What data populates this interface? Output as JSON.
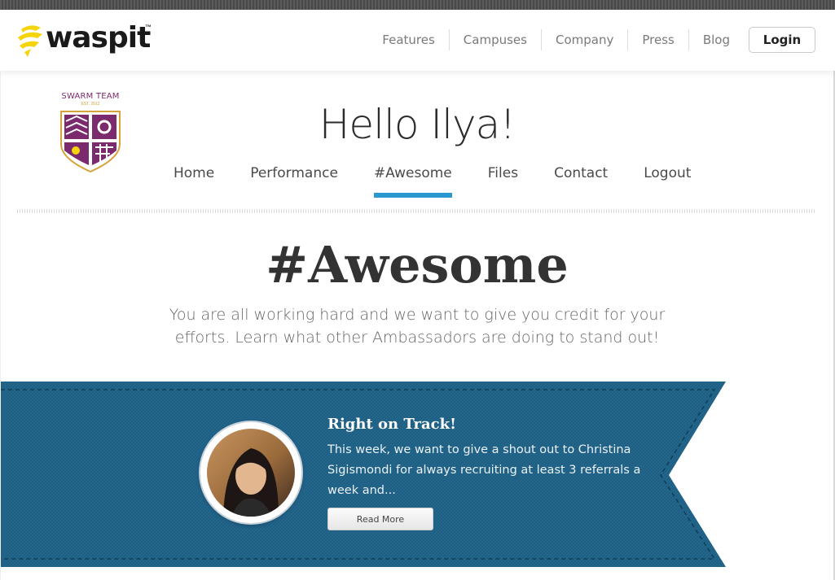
{
  "header": {
    "logo_text": "waspit",
    "logo_tm": "™",
    "nav": [
      "Features",
      "Campuses",
      "Company",
      "Press",
      "Blog"
    ],
    "login_label": "Login"
  },
  "badge": {
    "title": "SWARM TEAM",
    "subtitle": "EST. 2012"
  },
  "greeting": "Hello Ilya!",
  "sub_nav": {
    "items": [
      "Home",
      "Performance",
      "#Awesome",
      "Files",
      "Contact",
      "Logout"
    ],
    "active": "#Awesome"
  },
  "page": {
    "heading": "#Awesome",
    "intro": "You are all working hard and we want to give you credit for your efforts. Learn what other Ambassadors are doing to stand out!"
  },
  "feature_card": {
    "title": "Right on Track!",
    "text": "This week, we want to give a shout out to Christina Sigismondi for always recruiting at least 3 referrals a week and...",
    "button_label": "Read More"
  },
  "colors": {
    "accent": "#2a97d0",
    "ribbon": "#1f5f84",
    "badge_purple": "#7b2a6e",
    "logo_yellow": "#f5d40c"
  }
}
